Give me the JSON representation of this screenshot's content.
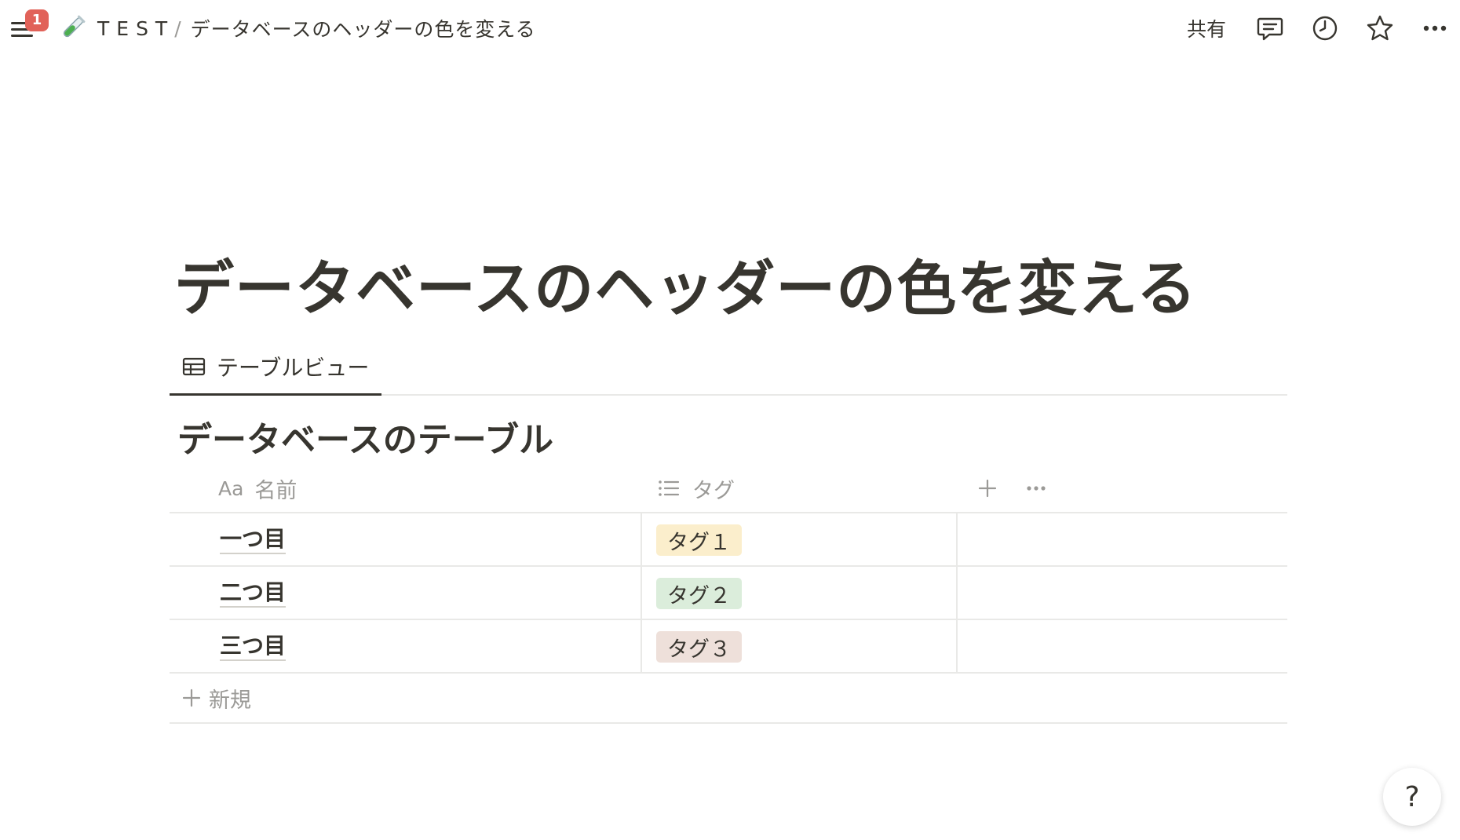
{
  "topbar": {
    "notification_count": "1",
    "breadcrumb_root": "TEST",
    "breadcrumb_separator": "/",
    "breadcrumb_page": "データベースのヘッダーの色を変える",
    "share_label": "共有",
    "icons": [
      "menu-icon",
      "test-tube-emoji-icon",
      "comment-icon",
      "clock-icon",
      "star-icon",
      "more-icon"
    ]
  },
  "page": {
    "title": "データベースのヘッダーの色を変える"
  },
  "views": {
    "active_tab": "テーブルビュー"
  },
  "database": {
    "title": "データベースのテーブル",
    "columns": [
      {
        "prefix": "Aa",
        "label": "名前"
      },
      {
        "label": "タグ"
      }
    ],
    "rows": [
      {
        "name": "一つ目",
        "tag": "タグ１",
        "tag_color": "#fbeecc"
      },
      {
        "name": "二つ目",
        "tag": "タグ２",
        "tag_color": "#dbeddb"
      },
      {
        "name": "三つ目",
        "tag": "タグ３",
        "tag_color": "#eee0da"
      }
    ],
    "new_row_label": "新規"
  },
  "help_label": "?",
  "colors": {
    "text": "#37352f",
    "muted": "#9b9a97",
    "badge": "#e16259",
    "divider": "#e9e9e7"
  }
}
